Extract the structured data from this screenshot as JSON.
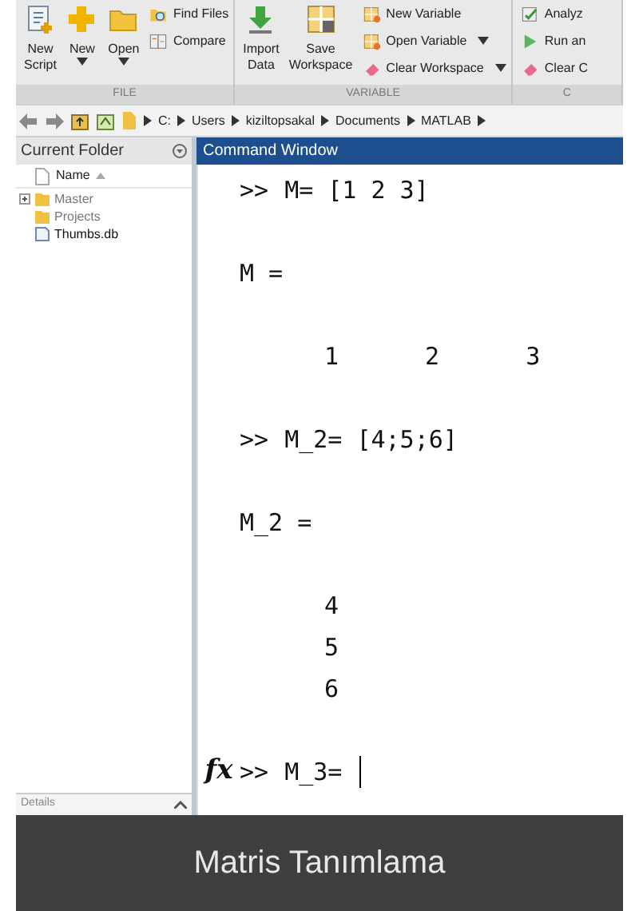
{
  "toolstrip": {
    "groups": [
      {
        "label": "FILE",
        "buttons": [
          {
            "kind": "large",
            "label": "New Script",
            "dropdown": false
          },
          {
            "kind": "large",
            "label": "New",
            "dropdown": true
          },
          {
            "kind": "large",
            "label": "Open",
            "dropdown": true
          },
          {
            "kind": "small",
            "label": "Find Files",
            "dropdown": false
          },
          {
            "kind": "small",
            "label": "Compare",
            "dropdown": false
          }
        ]
      },
      {
        "label": "VARIABLE",
        "buttons": [
          {
            "kind": "large",
            "label": "Import Data",
            "dropdown": false
          },
          {
            "kind": "large",
            "label": "Save Workspace",
            "dropdown": false
          },
          {
            "kind": "small",
            "label": "New Variable",
            "dropdown": false
          },
          {
            "kind": "small",
            "label": "Open Variable",
            "dropdown": true
          },
          {
            "kind": "small",
            "label": "Clear Workspace",
            "dropdown": true
          }
        ]
      },
      {
        "label": "C",
        "buttons": [
          {
            "kind": "small",
            "label": "Analyz"
          },
          {
            "kind": "small",
            "label": "Run an"
          },
          {
            "kind": "small",
            "label": "Clear C"
          }
        ]
      }
    ]
  },
  "address_bar": {
    "path": [
      "C:",
      "Users",
      "kiziltopsakal",
      "Documents",
      "MATLAB"
    ]
  },
  "current_folder": {
    "title": "Current Folder",
    "column": "Name",
    "items": [
      {
        "kind": "folder",
        "name": "Master",
        "expandable": true
      },
      {
        "kind": "folder",
        "name": "Projects",
        "expandable": false
      },
      {
        "kind": "file",
        "name": "Thumbs.db",
        "expandable": false
      }
    ],
    "details": "Details"
  },
  "command_window": {
    "title": "Command Window",
    "lines": [
      {
        "kind": "input",
        "prompt": ">>",
        "text": "M= [1 2 3]"
      },
      {
        "kind": "blank"
      },
      {
        "kind": "output",
        "text": "M ="
      },
      {
        "kind": "blank"
      },
      {
        "kind": "values",
        "values": [
          "1",
          "2",
          "3"
        ]
      },
      {
        "kind": "blank"
      },
      {
        "kind": "input",
        "prompt": ">>",
        "text": "M_2= [4;5;6]"
      },
      {
        "kind": "blank"
      },
      {
        "kind": "output",
        "text": "M_2 ="
      },
      {
        "kind": "blank"
      },
      {
        "kind": "values",
        "values": [
          "4"
        ]
      },
      {
        "kind": "values",
        "values": [
          "5"
        ]
      },
      {
        "kind": "values",
        "values": [
          "6"
        ]
      },
      {
        "kind": "blank"
      },
      {
        "kind": "current",
        "fx": "fx",
        "prompt": ">>",
        "text": "M_3="
      }
    ]
  },
  "caption": "Matris Tanımlama"
}
